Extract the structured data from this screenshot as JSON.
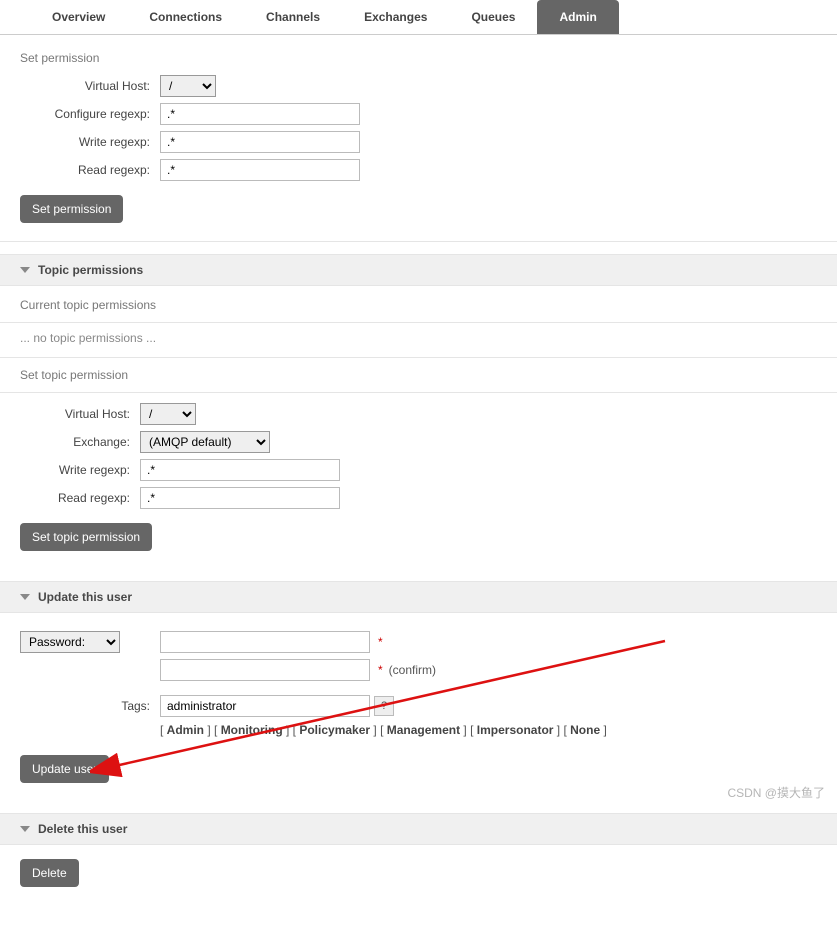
{
  "tabs": {
    "items": [
      "Overview",
      "Connections",
      "Channels",
      "Exchanges",
      "Queues",
      "Admin"
    ],
    "active": "Admin"
  },
  "perm": {
    "title": "Set permission",
    "vhost_label": "Virtual Host:",
    "vhost_value": "/",
    "configure_label": "Configure regexp:",
    "configure_value": ".*",
    "write_label": "Write regexp:",
    "write_value": ".*",
    "read_label": "Read regexp:",
    "read_value": ".*",
    "button": "Set permission"
  },
  "topic": {
    "header": "Topic permissions",
    "current_label": "Current topic permissions",
    "none_text": "... no topic permissions ...",
    "set_title": "Set topic permission",
    "vhost_label": "Virtual Host:",
    "vhost_value": "/",
    "exchange_label": "Exchange:",
    "exchange_value": "(AMQP default)",
    "write_label": "Write regexp:",
    "write_value": ".*",
    "read_label": "Read regexp:",
    "read_value": ".*",
    "button": "Set topic permission"
  },
  "update": {
    "header": "Update this user",
    "password_select": "Password:",
    "password_value": "",
    "confirm_value": "",
    "confirm_text": "(confirm)",
    "tags_label": "Tags:",
    "tags_value": "administrator",
    "help": "?",
    "tag_options": [
      "Admin",
      "Monitoring",
      "Policymaker",
      "Management",
      "Impersonator",
      "None"
    ],
    "button": "Update user"
  },
  "del": {
    "header": "Delete this user",
    "button": "Delete"
  },
  "watermark": "CSDN @摸大鱼了"
}
